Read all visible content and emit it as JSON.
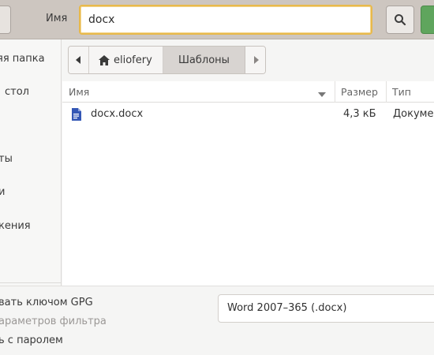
{
  "header": {
    "name_label": "Имя",
    "filename_value": "docx"
  },
  "sidebar": {
    "items": [
      {
        "label": "яя папка"
      },
      {
        "label": "стол"
      },
      {
        "label": "ты"
      },
      {
        "label": "и"
      },
      {
        "label": "кения"
      }
    ]
  },
  "pathbar": {
    "home_label": "eliofery",
    "current_label": "Шаблоны"
  },
  "filelist": {
    "columns": {
      "name": "Имя",
      "size": "Размер",
      "type": "Тип"
    },
    "rows": [
      {
        "name": "docx.docx",
        "size": "4,3 кБ",
        "type": "Докуме"
      }
    ]
  },
  "options": {
    "encrypt_gpg": "вать ключом GPG",
    "filter_params": "араметров фильтра",
    "with_password": "ь с паролем"
  },
  "filter": {
    "selected": "Word 2007–365 (.docx)"
  },
  "colors": {
    "header_bg": "#cdc6c0",
    "input_focus": "#e8b94b",
    "ok_button": "#5fa55d",
    "selected_path": "#d8d4d1"
  },
  "icons": {
    "search": "search-icon",
    "home": "home-icon",
    "document": "document-icon",
    "back": "chevron-left-icon",
    "forward": "chevron-right-icon",
    "sort": "sort-down-icon"
  }
}
